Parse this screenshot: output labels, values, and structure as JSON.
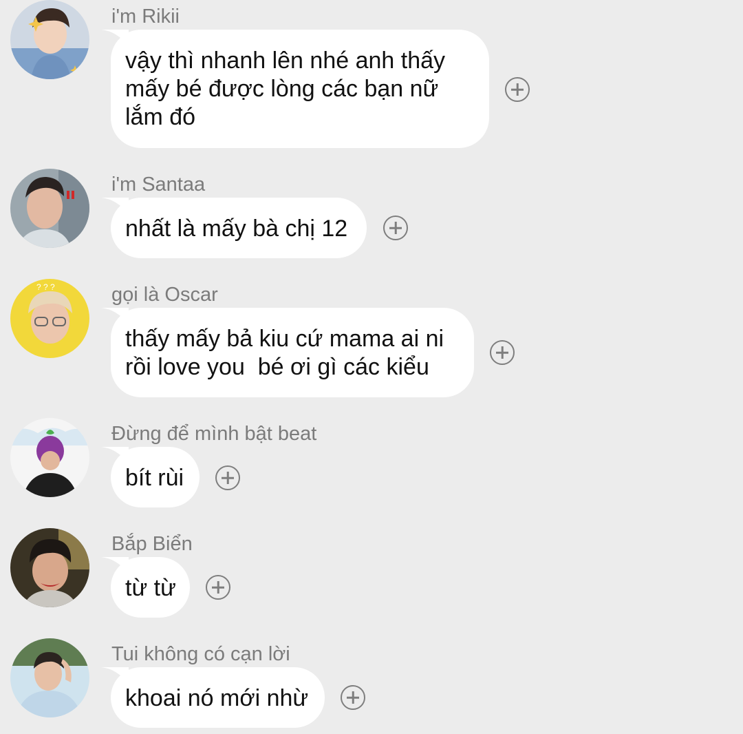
{
  "messages": [
    {
      "sender": "i'm Rikii",
      "lines": [
        "vậy thì nhanh lên nhé anh thấy",
        "mấy bé được lòng các bạn nữ",
        "lắm đó"
      ],
      "avatar": "avatar-rikii"
    },
    {
      "sender": "i'm Santaa",
      "lines": [
        "nhất là mấy bà chị 12"
      ],
      "avatar": "avatar-santaa"
    },
    {
      "sender": "gọi là Oscar",
      "lines": [
        "thấy mấy bả kiu cứ mama ai ni",
        "rồi love you  bé ơi gì các kiểu"
      ],
      "avatar": "avatar-oscar"
    },
    {
      "sender": "Đừng để mình bật beat",
      "lines": [
        "bít rùi"
      ],
      "avatar": "avatar-beat"
    },
    {
      "sender": "Bắp Biển",
      "lines": [
        "từ từ"
      ],
      "avatar": "avatar-bap-bien"
    },
    {
      "sender": "Tui không có cạn lời",
      "lines": [
        "khoai nó mới nhừ"
      ],
      "avatar": "avatar-tui"
    }
  ],
  "colors": {
    "background": "#ececec",
    "bubble": "#ffffff",
    "sender_text": "#7b7b7b",
    "message_text": "#111111",
    "add_icon": "#7e7e7e"
  },
  "icons": {
    "add_reaction": "plus-circle-icon"
  }
}
